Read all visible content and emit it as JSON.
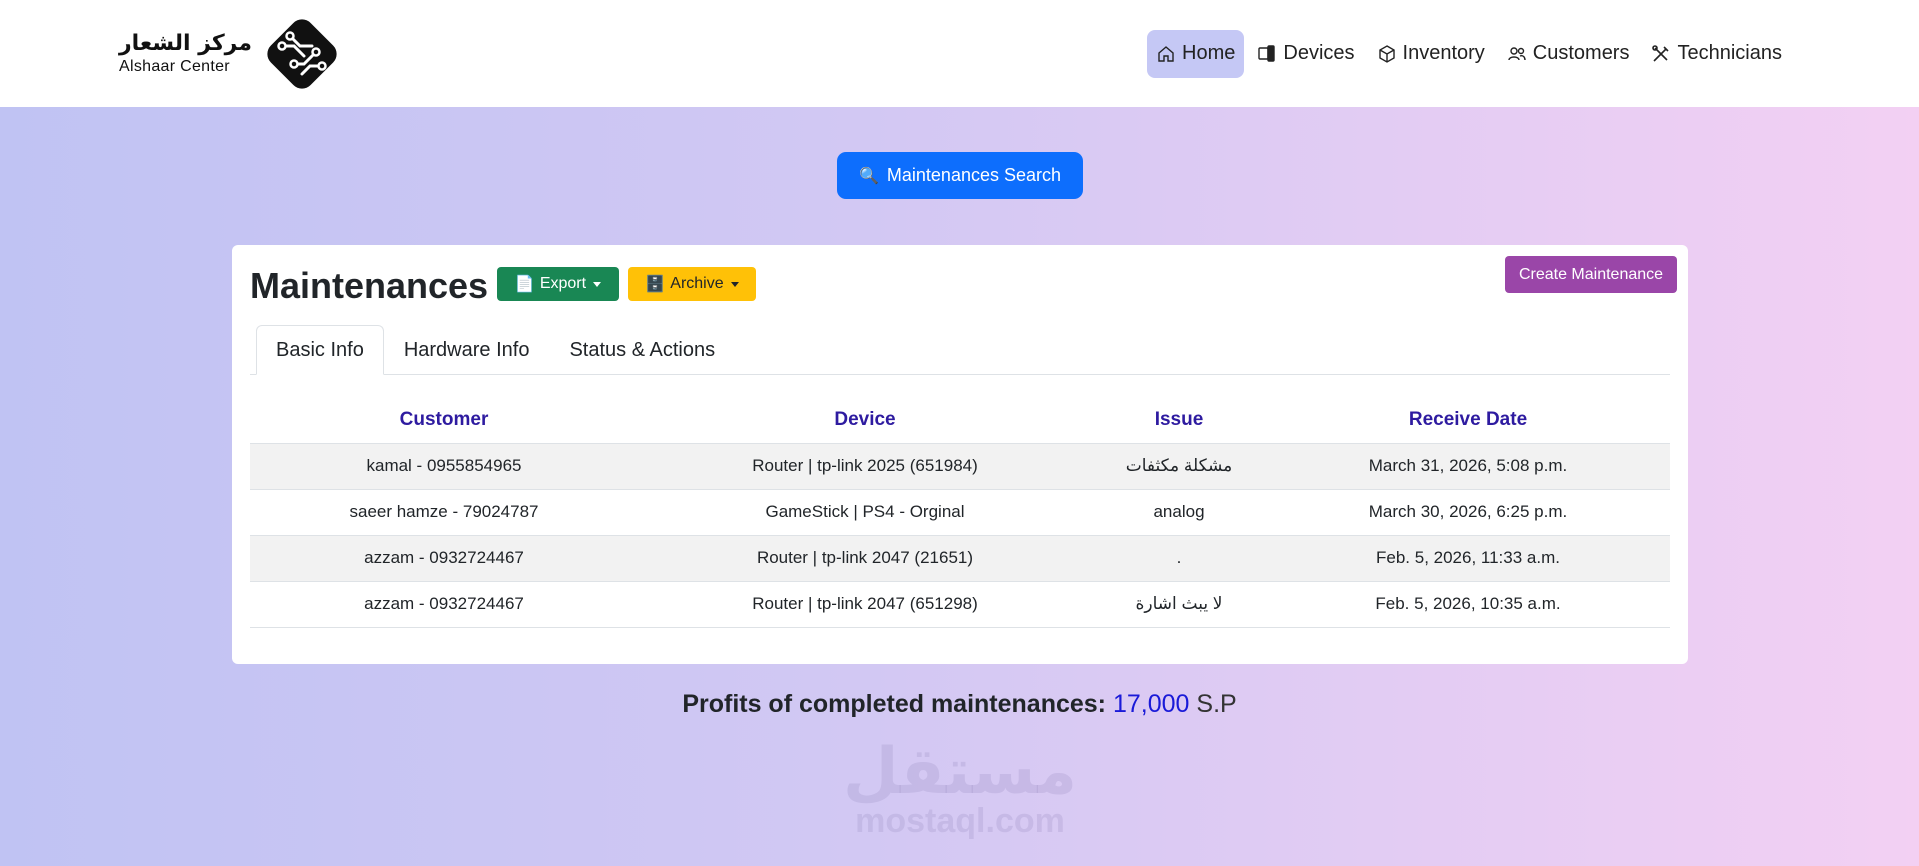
{
  "header": {
    "logo_ar": "مركز الشعار",
    "logo_en": "Alshaar Center",
    "nav": [
      {
        "label": "Home",
        "icon": "home-icon",
        "active": true
      },
      {
        "label": "Devices",
        "icon": "devices-icon"
      },
      {
        "label": "Inventory",
        "icon": "box-icon"
      },
      {
        "label": "Customers",
        "icon": "users-icon"
      },
      {
        "label": "Technicians",
        "icon": "tools-icon"
      }
    ]
  },
  "search_button": "Maintenances Search",
  "card": {
    "title": "Maintenances",
    "export_label": "Export",
    "archive_label": "Archive",
    "create_label": "Create Maintenance",
    "tabs": [
      "Basic Info",
      "Hardware Info",
      "Status & Actions"
    ],
    "columns": [
      "Customer",
      "Device",
      "Issue",
      "Receive Date"
    ],
    "rows": [
      [
        "kamal - 0955854965",
        "Router | tp-link 2025 (651984)",
        "مشكلة مكثفات",
        "March 31, 2026, 5:08 p.m."
      ],
      [
        "saeer hamze - 79024787",
        "GameStick | PS4 - Orginal",
        "analog",
        "March 30, 2026, 6:25 p.m."
      ],
      [
        "azzam - 0932724467",
        "Router | tp-link 2047 (21651)",
        ".",
        "Feb. 5, 2026, 11:33 a.m."
      ],
      [
        "azzam - 0932724467",
        "Router | tp-link 2047 (651298)",
        "لا يبث اشارة",
        "Feb. 5, 2026, 10:35 a.m."
      ]
    ]
  },
  "profits": {
    "label": "Profits of completed maintenances:",
    "amount": "17,000",
    "unit": "S.P"
  },
  "watermark": {
    "ar": "مستقل",
    "en": "mostaql.com"
  },
  "colors": {
    "primary": "#0d6efd",
    "export": "#198754",
    "archive": "#ffc107",
    "create": "#9a46a8",
    "header_text": "#2e1ba0"
  }
}
